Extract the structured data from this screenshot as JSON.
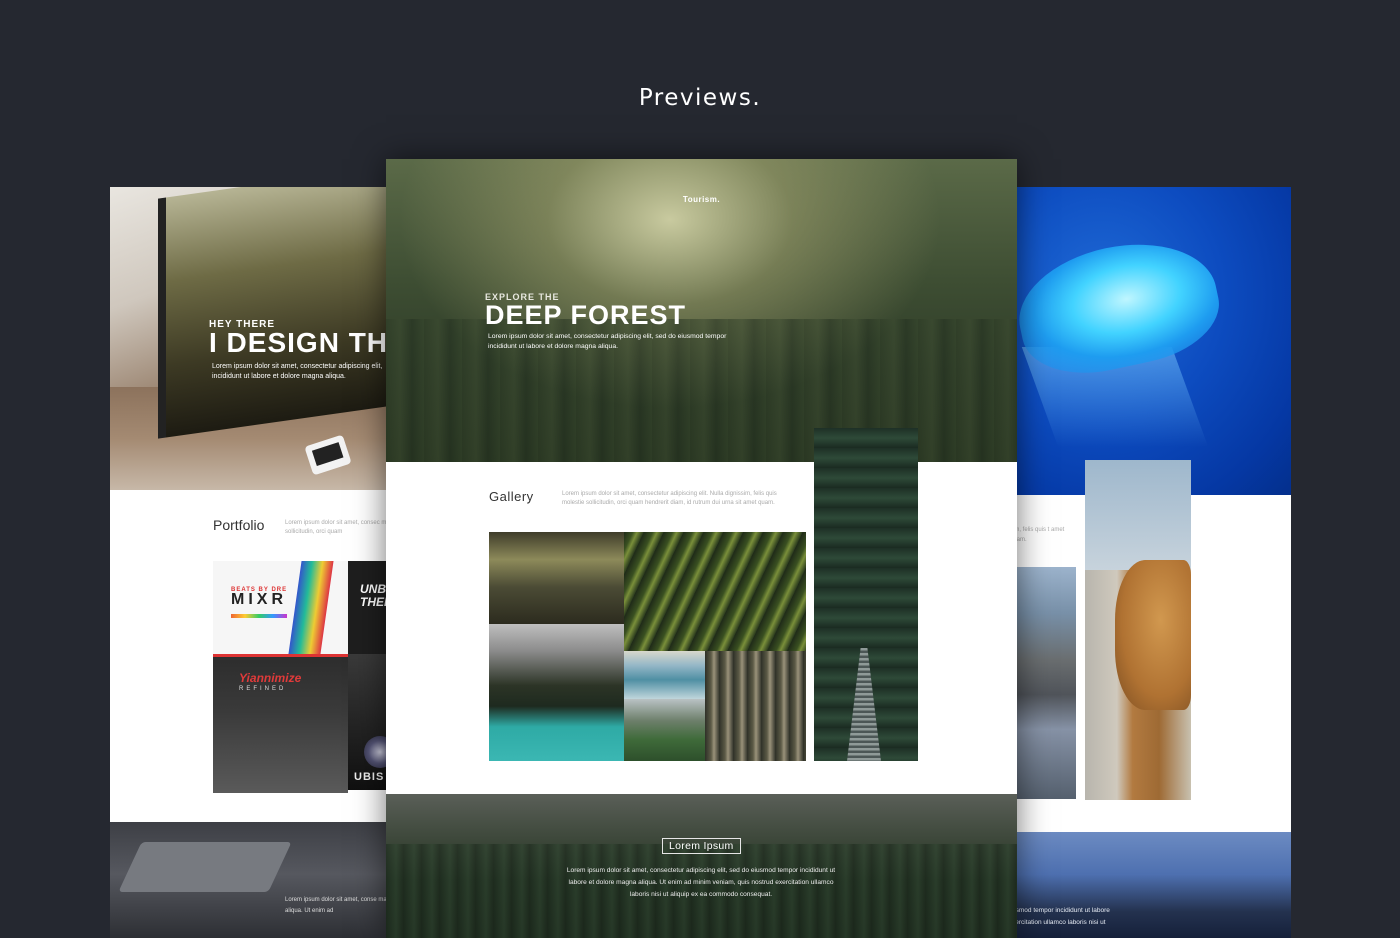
{
  "page": {
    "title": "Previews."
  },
  "left_preview": {
    "eyebrow": "HEY THERE",
    "heading": "I DESIGN THI",
    "body": "Lorem ipsum dolor sit amet, consectetur adipiscing elit, incididunt ut labore et dolore magna aliqua.",
    "section_title": "Portfolio",
    "section_text": "Lorem ipsum dolor sit amet, consec molestie sollicitudin, orci quam",
    "tiles": {
      "mixr_tag": "BEATS BY DRE",
      "mixr_logo": "MIXR",
      "unb_text": "UNB THER",
      "yian_logo": "Yiannimize",
      "yian_sub": "REFINED",
      "ubi_text": "UBIS"
    },
    "footer_text": "Lorem ipsum dolor sit amet, conse magna aliqua. Ut enim ad"
  },
  "center_preview": {
    "brand": "Tourism.",
    "eyebrow": "EXPLORE THE",
    "heading": "DEEP FOREST",
    "body": "Lorem ipsum dolor sit amet, consectetur adipiscing elit, sed do eiusmod tempor incididunt ut labore et dolore magna aliqua.",
    "gallery_title": "Gallery",
    "gallery_text": "Lorem ipsum dolor sit amet, consectetur adipiscing elit. Nulla dignissim, felis quis molestie sollicitudin, orci quam hendrerit diam, id rutrum dui urna sit amet quam.",
    "cta_label": "Lorem Ipsum",
    "footer_text": "Lorem ipsum dolor sit amet, consectetur adipiscing elit, sed do eiusmod tempor incididunt ut labore et dolore magna aliqua. Ut enim ad minim veniam, quis nostrud exercitation ullamco laboris nisi ut aliquip ex ea commodo consequat."
  },
  "right_preview": {
    "section_text": "sim, felis quis t amet quam.",
    "footer_text": "usmod tempor incididunt ut labore xercitation ullamco laboris nisi ut"
  }
}
